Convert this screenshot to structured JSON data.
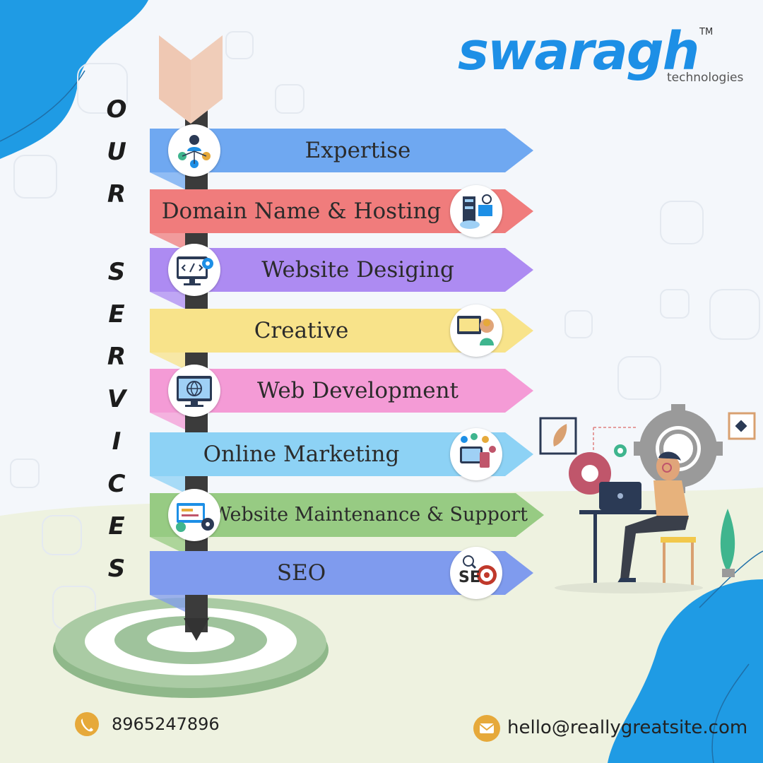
{
  "brand": {
    "name": "swaragh",
    "tagline": "technologies",
    "trademark": "TM",
    "color": "#1d8fe6"
  },
  "heading": {
    "letters_word1": [
      "O",
      "U",
      "R"
    ],
    "letters_word2": [
      "S",
      "E",
      "R",
      "V",
      "I",
      "C",
      "E",
      "S"
    ]
  },
  "services": [
    {
      "label": "Expertise",
      "color": "#6fa8f1",
      "icon": "team-network-icon",
      "icon_side": "left"
    },
    {
      "label": "Domain Name & Hosting",
      "color": "#f07c7c",
      "icon": "server-cloud-icon",
      "icon_side": "right"
    },
    {
      "label": "Website Desiging",
      "color": "#ad8bf2",
      "icon": "code-monitor-icon",
      "icon_side": "left"
    },
    {
      "label": "Creative",
      "color": "#f8e38a",
      "icon": "creative-mind-icon",
      "icon_side": "right"
    },
    {
      "label": "Web Development",
      "color": "#f49bd6",
      "icon": "globe-monitor-icon",
      "icon_side": "left"
    },
    {
      "label": "Online Marketing",
      "color": "#8dd2f5",
      "icon": "social-marketing-icon",
      "icon_side": "right"
    },
    {
      "label": "Website Maintenance & Support",
      "color": "#97cb83",
      "icon": "maintenance-gears-icon",
      "icon_side": "left"
    },
    {
      "label": "SEO",
      "color": "#7f9bee",
      "icon": "seo-target-icon",
      "icon_side": "right"
    }
  ],
  "contact": {
    "phone": "8965247896",
    "email": "hello@reallygreatsite.com",
    "phone_icon": "phone-icon",
    "email_icon": "mail-icon",
    "accent": "#e6a93a"
  },
  "colors": {
    "blob_blue": "#1f9be4",
    "pole": "#3b3b3b",
    "target_green": "#9fc39c"
  }
}
